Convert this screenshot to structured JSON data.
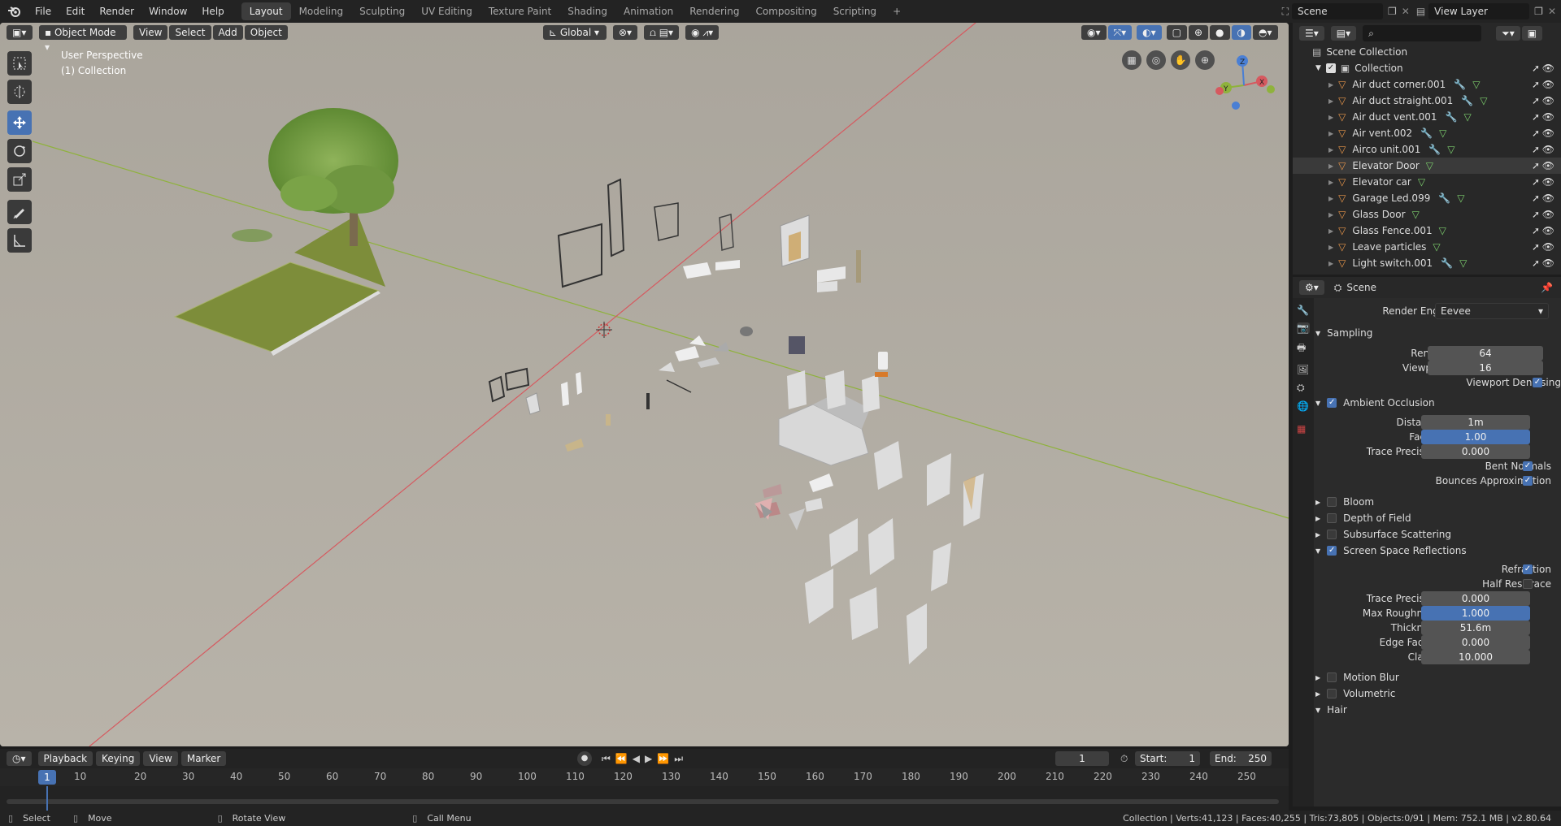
{
  "menu": [
    "File",
    "Edit",
    "Render",
    "Window",
    "Help"
  ],
  "workspaces": [
    "Layout",
    "Modeling",
    "Sculpting",
    "UV Editing",
    "Texture Paint",
    "Shading",
    "Animation",
    "Rendering",
    "Compositing",
    "Scripting"
  ],
  "active_workspace": "Layout",
  "scene_name": "Scene",
  "view_layer": "View Layer",
  "viewport": {
    "mode": "Object Mode",
    "menus": [
      "View",
      "Select",
      "Add",
      "Object"
    ],
    "transform_orientation": "Global",
    "perspective_label": "User Perspective",
    "collection_label": "(1) Collection",
    "gizmo_axes": [
      "X",
      "Y",
      "Z"
    ]
  },
  "outliner": {
    "root": "Scene Collection",
    "collection": "Collection",
    "items": [
      {
        "name": "Air duct corner.001",
        "modifier": true
      },
      {
        "name": "Air duct straight.001",
        "modifier": true
      },
      {
        "name": "Air duct vent.001",
        "modifier": true
      },
      {
        "name": "Air vent.002",
        "modifier": true
      },
      {
        "name": "Airco unit.001",
        "modifier": true
      },
      {
        "name": "Elevator Door",
        "modifier": false
      },
      {
        "name": "Elevator car",
        "modifier": false
      },
      {
        "name": "Garage Led.099",
        "modifier": true
      },
      {
        "name": "Glass Door",
        "modifier": false
      },
      {
        "name": "Glass Fence.001",
        "modifier": false
      },
      {
        "name": "Leave particles",
        "modifier": false
      },
      {
        "name": "Light switch.001",
        "modifier": true
      }
    ]
  },
  "properties": {
    "context": "Scene",
    "render_engine_label": "Render Engine",
    "render_engine": "Eevee",
    "sampling": {
      "title": "Sampling",
      "render_label": "Render",
      "render": "64",
      "viewport_label": "Viewport",
      "viewport": "16",
      "denoise_label": "Viewport Denoising"
    },
    "ao": {
      "title": "Ambient Occlusion",
      "distance_label": "Distance",
      "distance": "1m",
      "factor_label": "Factor",
      "factor": "1.00",
      "trace_label": "Trace Precision",
      "trace": "0.000",
      "bent_label": "Bent Normals",
      "bounces_label": "Bounces Approximation"
    },
    "bloom": "Bloom",
    "dof": "Depth of Field",
    "sss": "Subsurface Scattering",
    "ssr": {
      "title": "Screen Space Reflections",
      "refraction_label": "Refraction",
      "halfres_label": "Half Res Trace",
      "trace_label": "Trace Precision",
      "trace": "0.000",
      "rough_label": "Max Roughness",
      "rough": "1.000",
      "thick_label": "Thickness",
      "thick": "51.6m",
      "fade_label": "Edge Fading",
      "fade": "0.000",
      "clamp_label": "Clamp",
      "clamp": "10.000"
    },
    "motion_blur": "Motion Blur",
    "volumetric": "Volumetric",
    "hair": "Hair"
  },
  "timeline": {
    "menus": [
      "Playback",
      "Keying",
      "View",
      "Marker"
    ],
    "current_frame": "1",
    "start_label": "Start:",
    "start": "1",
    "end_label": "End:",
    "end": "250",
    "ticks": [
      "10",
      "20",
      "30",
      "40",
      "50",
      "60",
      "70",
      "80",
      "90",
      "100",
      "110",
      "120",
      "130",
      "140",
      "150",
      "160",
      "170",
      "180",
      "190",
      "200",
      "210",
      "220",
      "230",
      "240",
      "250"
    ]
  },
  "statusbar": {
    "select": "Select",
    "move": "Move",
    "rotate": "Rotate View",
    "call_menu": "Call Menu",
    "stats": "Collection | Verts:41,123 | Faces:40,255 | Tris:73,805 | Objects:0/91 | Mem: 752.1 MB | v2.80.64"
  }
}
